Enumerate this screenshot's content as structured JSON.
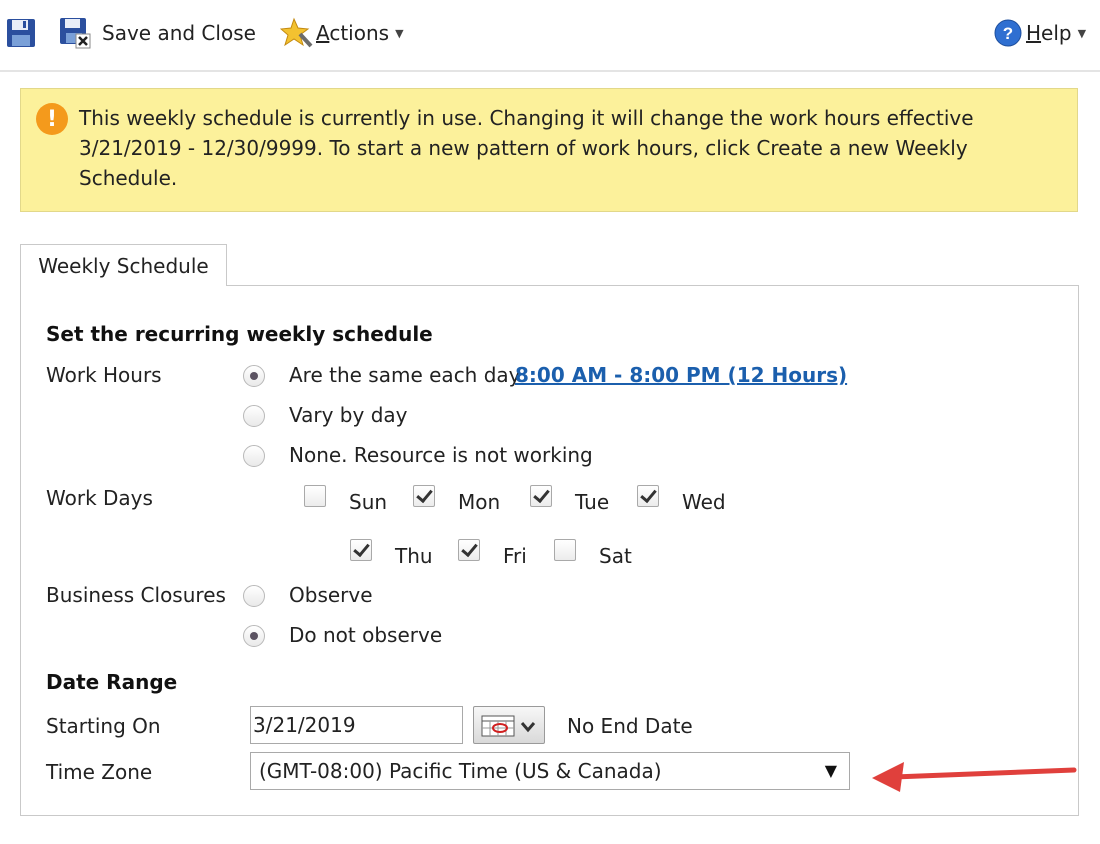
{
  "toolbar": {
    "save_close_label": "Save and Close",
    "actions_prefix": "A",
    "actions_rest": "ctions",
    "help_prefix": "H",
    "help_rest": "elp"
  },
  "notice": {
    "text": "This weekly schedule is currently in use. Changing it will change the work hours effective 3/21/2019 - 12/30/9999. To start a new pattern of work hours, click Create a new Weekly Schedule."
  },
  "tab": {
    "label": "Weekly Schedule"
  },
  "schedule": {
    "title": "Set the recurring weekly schedule",
    "work_hours_label": "Work Hours",
    "same_each_day_label": "Are the same each day",
    "hours_link": "8:00 AM - 8:00 PM (12 Hours)",
    "vary_label": "Vary by day",
    "none_label": "None. Resource is not working",
    "work_days_label": "Work Days",
    "days": [
      {
        "name": "Sun",
        "checked": false
      },
      {
        "name": "Mon",
        "checked": true
      },
      {
        "name": "Tue",
        "checked": true
      },
      {
        "name": "Wed",
        "checked": true
      },
      {
        "name": "Thu",
        "checked": true
      },
      {
        "name": "Fri",
        "checked": true
      },
      {
        "name": "Sat",
        "checked": false
      }
    ],
    "closures_label": "Business Closures",
    "observe_label": "Observe",
    "not_observe_label": "Do not observe"
  },
  "date_range": {
    "title": "Date Range",
    "start_label": "Starting On",
    "start_value": "3/21/2019",
    "no_end_label": "No End Date",
    "tz_label": "Time Zone",
    "tz_value": "(GMT-08:00) Pacific Time (US & Canada)"
  },
  "colors": {
    "notice_bg": "#fcf19b",
    "link": "#1b5fad",
    "annotation_arrow": "#e0403c"
  }
}
